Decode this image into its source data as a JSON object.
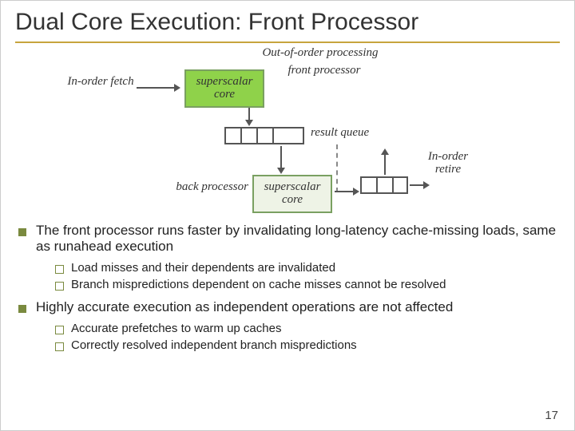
{
  "title": "Dual Core Execution: Front Processor",
  "diagram": {
    "labels": {
      "in_order_fetch": "In-order fetch",
      "ooo_processing": "Out-of-order processing",
      "front_processor": "front processor",
      "result_queue": "result queue",
      "back_processor": "back processor",
      "in_order_retire": "In-order retire"
    },
    "boxes": {
      "core_label": "superscalar core"
    }
  },
  "bullets": [
    {
      "text": "The front processor runs faster by invalidating long-latency cache-missing loads, same as runahead execution",
      "sub": [
        "Load misses and their dependents are invalidated",
        "Branch mispredictions dependent on cache misses cannot be resolved"
      ]
    },
    {
      "text": "Highly accurate execution as independent operations are not affected",
      "sub": [
        "Accurate prefetches to warm up caches",
        "Correctly resolved independent branch mispredictions"
      ]
    }
  ],
  "page_number": "17"
}
